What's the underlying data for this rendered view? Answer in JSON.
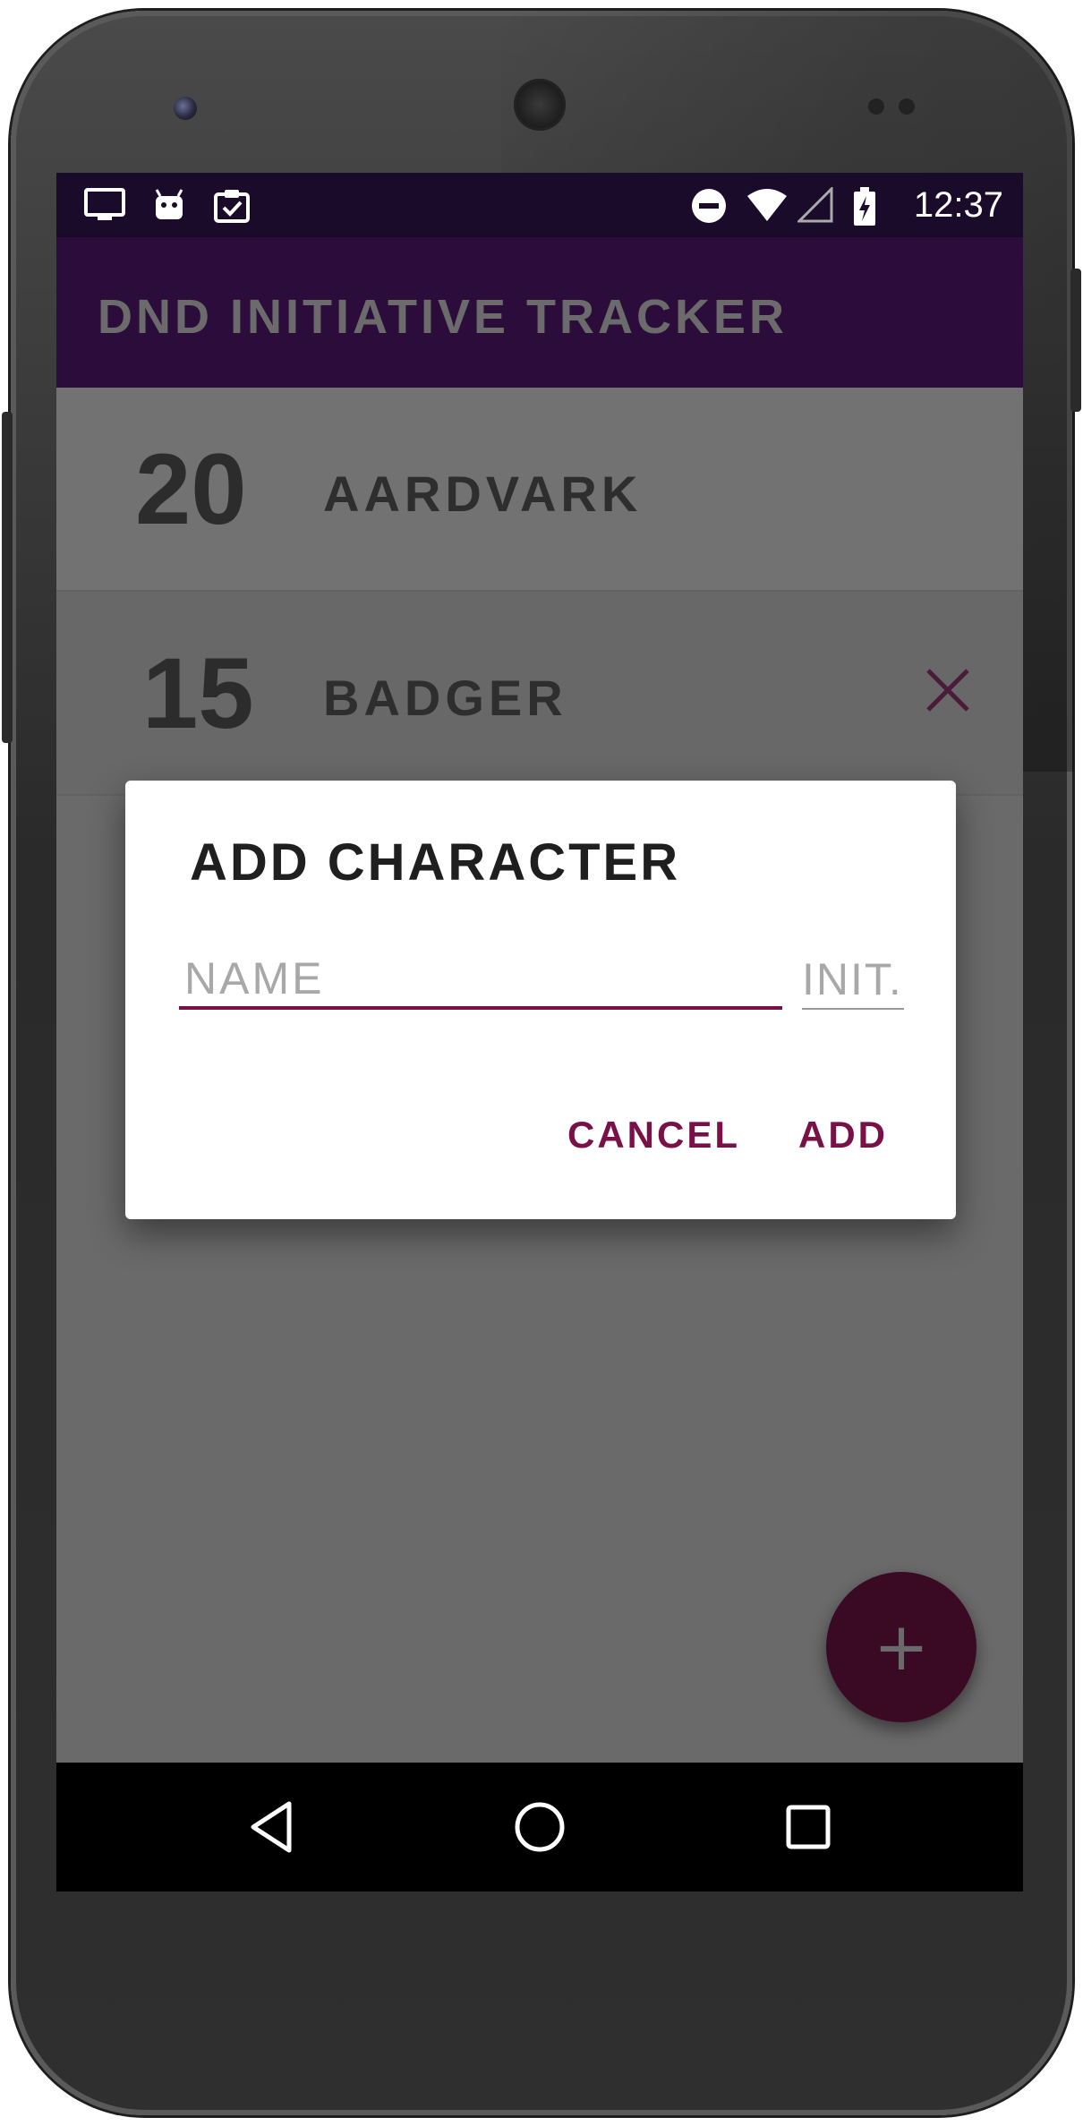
{
  "status_bar": {
    "time": "12:37",
    "icons": [
      "screen-cast-icon",
      "android-icon",
      "clipboard-check-icon",
      "do-not-disturb-icon",
      "wifi-icon",
      "cell-signal-icon",
      "battery-charging-icon"
    ]
  },
  "app_bar": {
    "title": "DND INITIATIVE TRACKER"
  },
  "characters": [
    {
      "initiative": "20",
      "name": "AARDVARK"
    },
    {
      "initiative": "15",
      "name": "BADGER",
      "remove_icon": "close-icon"
    }
  ],
  "dialog": {
    "title": "ADD CHARACTER",
    "name_placeholder": "NAME",
    "initiative_placeholder": "INIT.",
    "cancel_label": "CANCEL",
    "add_label": "ADD"
  },
  "fab": {
    "label": "+",
    "icon": "plus-icon"
  },
  "nav_bar": {
    "icons": [
      "back-icon",
      "home-icon",
      "recents-icon"
    ]
  },
  "colors": {
    "app_bar": "#2b0c3b",
    "status_bar": "#1b0b2a",
    "accent": "#7a1048",
    "scrim_background": "#6a6a6a"
  }
}
